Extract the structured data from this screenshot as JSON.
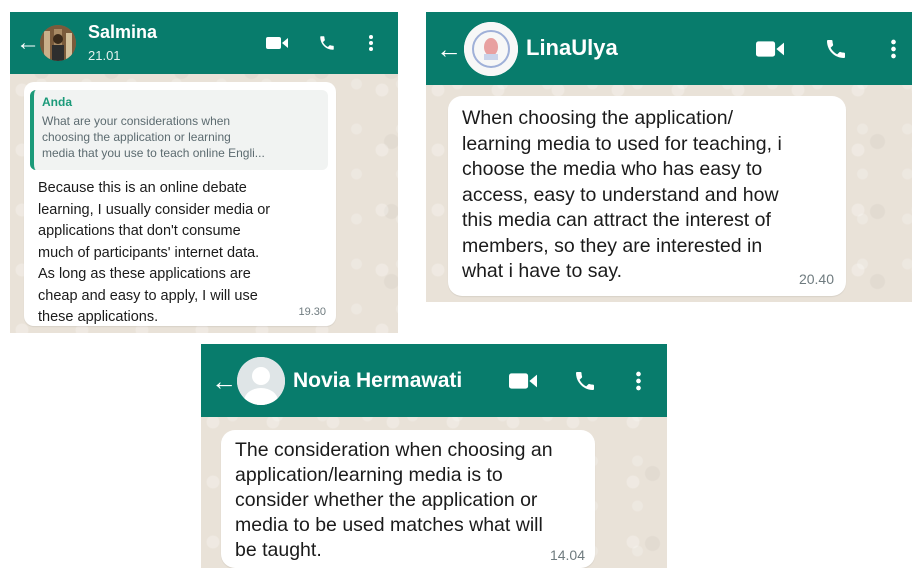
{
  "chats": [
    {
      "contact_name": "Salmina",
      "subtitle": "21.01",
      "quote": {
        "author": "Anda",
        "text": "What are your considerations when\nchoosing the application or learning\nmedia that you use to teach online Engli..."
      },
      "message": "Because this is an online debate\nlearning, I usually consider media or\napplications that don't consume\nmuch of participants' internet data.\nAs long as these applications are\ncheap and easy to apply, I will use\nthese applications.",
      "time": "19.30"
    },
    {
      "contact_name": "LinaUlya",
      "message": "When choosing the application/\nlearning media to used for teaching, i\nchoose the media who has easy to\naccess, easy to understand and how\nthis media can attract the interest of\nmembers, so they are interested in\nwhat i have to say.",
      "time": "20.40"
    },
    {
      "contact_name": "Novia Hermawati",
      "message": "The consideration when choosing an\napplication/learning media is to\nconsider whether the application or\nmedia to be used matches what will\nbe taught.",
      "time": "14.04"
    }
  ],
  "icons": {
    "back": "arrow-left-icon",
    "video": "video-camera-icon",
    "call": "phone-icon",
    "menu": "more-vertical-icon"
  },
  "colors": {
    "header": "#087c6c",
    "chat_background": "#e9e2d8",
    "bubble": "#ffffff",
    "quote_accent": "#1b9a79"
  }
}
